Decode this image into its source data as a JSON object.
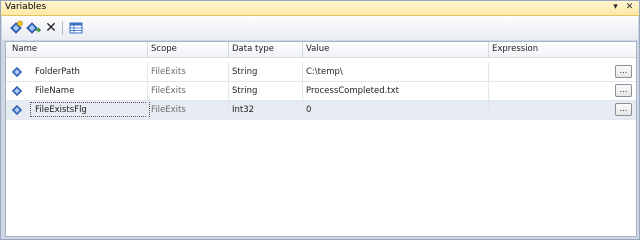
{
  "panel": {
    "title": "Variables"
  },
  "titlebar": {
    "pin_glyph": "▾",
    "close_glyph": "✕"
  },
  "toolbar": {
    "buttons": [
      {
        "name": "add-variable-button",
        "icon": "add-variable-icon"
      },
      {
        "name": "move-variable-button",
        "icon": "move-variable-icon"
      },
      {
        "name": "delete-variable-button",
        "icon": "delete-icon",
        "glyph": "✕"
      },
      {
        "name": "choose-columns-button",
        "icon": "grid-columns-icon"
      }
    ]
  },
  "grid": {
    "columns": [
      "Name",
      "Scope",
      "Data type",
      "Value",
      "Expression"
    ],
    "rows": [
      {
        "name": "FolderPath",
        "scope": "FileExits",
        "data_type": "String",
        "value": "C:\\temp\\",
        "expression": "",
        "button": "..."
      },
      {
        "name": "FileName",
        "scope": "FileExits",
        "data_type": "String",
        "value": "ProcessCompleted.txt",
        "expression": "",
        "button": "..."
      },
      {
        "name": "FileExistsFlg",
        "scope": "FileExits",
        "data_type": "Int32",
        "value": "0",
        "expression": "",
        "button": "...",
        "selected": true
      }
    ]
  },
  "colors": {
    "titlebar": "#ffe8a6",
    "selected_row": "#e7ebf2",
    "panel_border": "#9aa6bd"
  }
}
